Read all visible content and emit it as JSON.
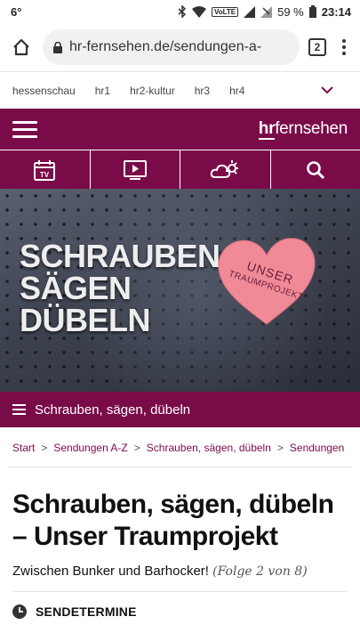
{
  "status_bar": {
    "left": "6°",
    "volte": "VoLTE",
    "battery": "59 %",
    "time": "23:14"
  },
  "browser": {
    "url": "hr-fernsehen.de/sendungen-a-",
    "tab_count": "2"
  },
  "channel_nav": {
    "items": [
      "hessenschau",
      "hr1",
      "hr2-kultur",
      "hr3",
      "hr4"
    ]
  },
  "site_header": {
    "logo_hr": "hr",
    "logo_rest": "fernsehen"
  },
  "icon_bar": {
    "tv_label": "TV",
    "icons": [
      "tv-icon",
      "play-icon",
      "weather-icon",
      "search-icon"
    ]
  },
  "hero": {
    "lines": [
      "SCHRAUBEN",
      "SÄGEN",
      "DÜBELN"
    ],
    "heart_line1": "UNSER",
    "heart_line2": "TRAUMPROJEKT",
    "heart_color": "#f08a96"
  },
  "program_bar": {
    "label": "Schrauben, sägen, dübeln"
  },
  "breadcrumb": {
    "items": [
      "Start",
      "Sendungen A-Z",
      "Schrauben, sägen, dübeln",
      "Sendungen"
    ],
    "separator": ">"
  },
  "article": {
    "title": "Schrauben, sägen, dübeln – Unser Traumprojekt",
    "subtitle": "Zwischen Bunker und Barhocker!",
    "episode": "(Folge 2 von 8)",
    "section_label": "SENDETERMINE"
  },
  "colors": {
    "brand": "#7a0b49"
  }
}
